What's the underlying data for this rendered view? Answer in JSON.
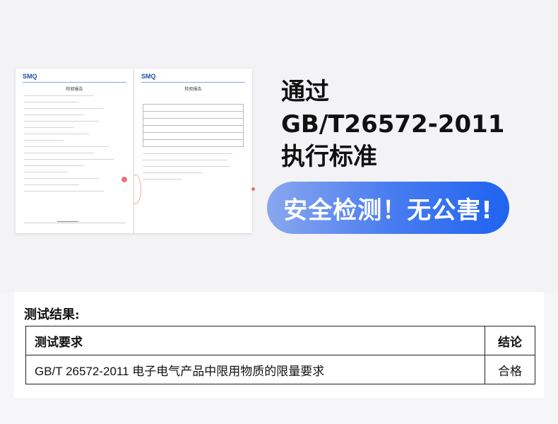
{
  "documents": {
    "logo": "SMQ",
    "left_title": "检验报告",
    "right_title": "检验报告"
  },
  "headline": {
    "line1": "通过",
    "line2": "GB/T26572-2011",
    "line3": "执行标准"
  },
  "badge": {
    "text": "安全检测！无公害!"
  },
  "results": {
    "title": "测试结果:",
    "header_requirement": "测试要求",
    "header_conclusion": "结论",
    "row_requirement": "GB/T 26572-2011  电子电气产品中限用物质的限量要求",
    "row_conclusion": "合格"
  },
  "colors": {
    "badge_start": "#8aa7ef",
    "badge_end": "#1f63f0",
    "logo": "#1f4fa0"
  }
}
